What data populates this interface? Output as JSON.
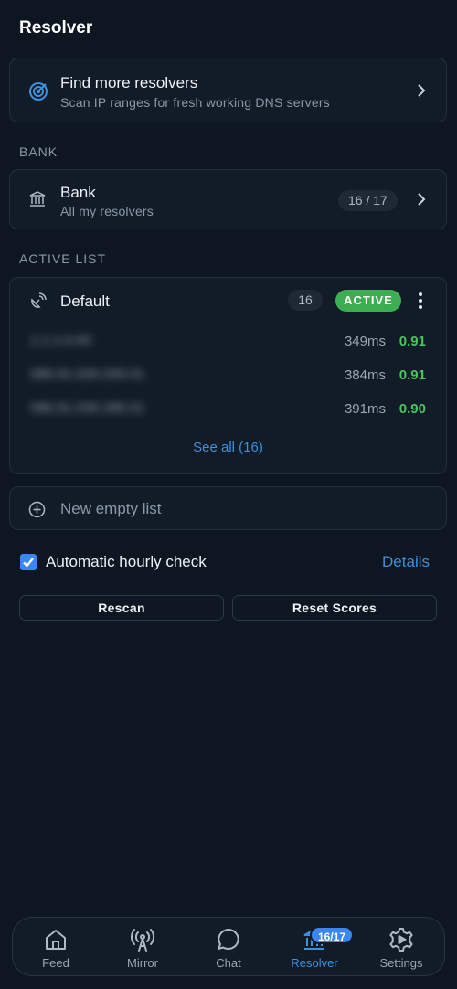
{
  "header": {
    "title": "Resolver"
  },
  "find_more": {
    "title": "Find more resolvers",
    "subtitle": "Scan IP ranges for fresh working DNS servers"
  },
  "bank_section": {
    "label": "BANK"
  },
  "bank": {
    "title": "Bank",
    "subtitle": "All my resolvers",
    "count": "16 / 17"
  },
  "active_section": {
    "label": "ACTIVE LIST"
  },
  "active_list": {
    "name": "Default",
    "count": "16",
    "status": "ACTIVE",
    "rows": [
      {
        "ip": "1.1.1.0.00",
        "latency": "349ms",
        "score": "0.91"
      },
      {
        "ip": "086.91.026.200.01",
        "latency": "384ms",
        "score": "0.91"
      },
      {
        "ip": "086.91.036.286.01",
        "latency": "391ms",
        "score": "0.90"
      }
    ],
    "see_all": "See all (16)"
  },
  "new_list": {
    "label": "New empty list"
  },
  "auto_check": {
    "label": "Automatic hourly check",
    "checked": true,
    "details": "Details"
  },
  "actions": {
    "rescan": "Rescan",
    "reset_scores": "Reset Scores"
  },
  "nav": {
    "items": [
      {
        "label": "Feed",
        "icon": "home-icon"
      },
      {
        "label": "Mirror",
        "icon": "antenna-icon"
      },
      {
        "label": "Chat",
        "icon": "chat-bubble-icon"
      },
      {
        "label": "Resolver",
        "icon": "bank-icon",
        "badge": "16/17",
        "active": true
      },
      {
        "label": "Settings",
        "icon": "gear-play-icon"
      }
    ]
  },
  "colors": {
    "background": "#0e1621",
    "accent": "#3f8fd9",
    "active_green": "#3cae51",
    "score_green": "#4cc35d"
  }
}
